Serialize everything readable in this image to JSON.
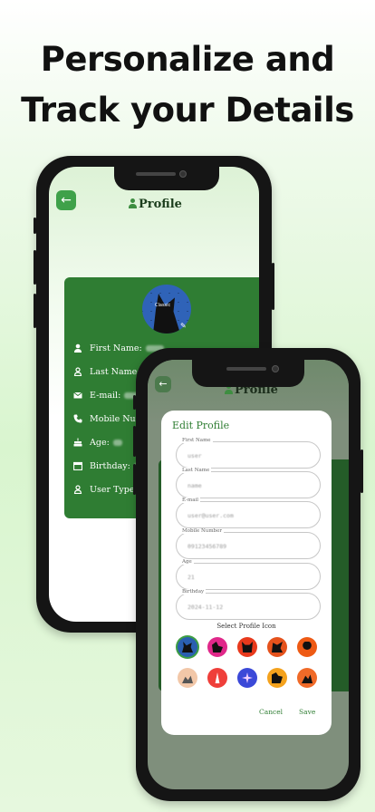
{
  "headline": {
    "line1": "Personalize and",
    "line2": "Track your Details"
  },
  "back_screen": {
    "back_button_icon": "arrow-left-icon",
    "title": "Profile",
    "avatar_caption": "Classic",
    "rows": [
      {
        "icon": "person-icon",
        "label": "First Name:"
      },
      {
        "icon": "person-outline-icon",
        "label": "Last Name:"
      },
      {
        "icon": "mail-icon",
        "label": "E-mail:"
      },
      {
        "icon": "phone-icon",
        "label": "Mobile Number:"
      },
      {
        "icon": "cake-icon",
        "label": "Age:"
      },
      {
        "icon": "calendar-icon",
        "label": "Birthday:"
      },
      {
        "icon": "person-outline-icon",
        "label": "User Type:"
      }
    ]
  },
  "front_screen": {
    "back_button_icon": "arrow-left-icon",
    "title": "Profile",
    "dialog": {
      "title": "Edit Profile",
      "fields": [
        {
          "label": "First Name",
          "value": "user"
        },
        {
          "label": "Last Name",
          "value": "name"
        },
        {
          "label": "E-mail",
          "value": "user@user.com"
        },
        {
          "label": "Mobile Number",
          "value": "09123456789"
        },
        {
          "label": "Age",
          "value": "21"
        },
        {
          "label": "Birthday",
          "value": "2024-11-12"
        }
      ],
      "select_icon_label": "Select Profile Icon",
      "cancel_label": "Cancel",
      "save_label": "Save",
      "profile_icons": [
        {
          "name": "dog-blue-icon",
          "bg": "#2a5fb0",
          "selected": true
        },
        {
          "name": "dog-pink-icon",
          "bg": "#e0288a"
        },
        {
          "name": "cat-red-icon",
          "bg": "#e8391c"
        },
        {
          "name": "wolf-orange-icon",
          "bg": "#e5521c"
        },
        {
          "name": "person-orange-icon",
          "bg": "#ee5a14"
        },
        {
          "name": "landscape-peach-icon",
          "bg": "#f2c7a8"
        },
        {
          "name": "tower-red-icon",
          "bg": "#ef3f3a"
        },
        {
          "name": "sparkle-blue-icon",
          "bg": "#3b49d8"
        },
        {
          "name": "cat-yellow-icon",
          "bg": "#f4a21d"
        },
        {
          "name": "mountain-orange-icon",
          "bg": "#f06a28"
        }
      ]
    }
  },
  "colors": {
    "primary_green": "#2f7d33",
    "accent_green": "#3fa14a"
  }
}
